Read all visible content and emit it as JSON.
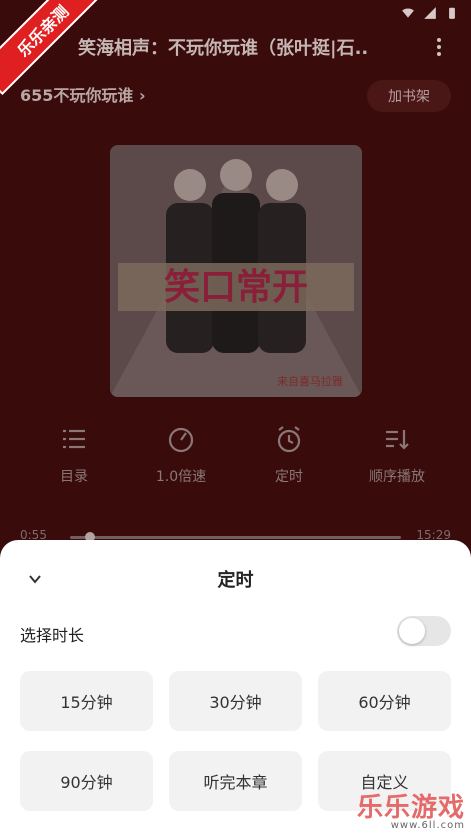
{
  "watermark": {
    "text": "乐乐亲测"
  },
  "header": {
    "title": "笑海相声：不玩你玩谁（张叶挺|石..",
    "subtitle": "655不玩你玩谁 ›",
    "shelf_button": "加书架"
  },
  "cover": {
    "title_text": "笑口常开",
    "source_text": "来自喜马拉雅"
  },
  "controls": [
    {
      "label": "目录",
      "icon": "list-icon"
    },
    {
      "label": "1.0倍速",
      "icon": "speed-icon"
    },
    {
      "label": "定时",
      "icon": "alarm-icon"
    },
    {
      "label": "顺序播放",
      "icon": "sort-icon"
    }
  ],
  "progress": {
    "current": "0:55",
    "total": "15:29",
    "fraction": 0.06
  },
  "sheet": {
    "title": "定时",
    "duration_label": "选择时长",
    "toggle_on": false,
    "options": [
      "15分钟",
      "30分钟",
      "60分钟",
      "90分钟",
      "听完本章",
      "自定义"
    ]
  },
  "brand": {
    "name": "乐乐游戏",
    "url": "www.6ll.com"
  },
  "colors": {
    "background": "#3a0b0b",
    "sheet": "#ffffff",
    "option_bg": "#f2f2f2"
  }
}
